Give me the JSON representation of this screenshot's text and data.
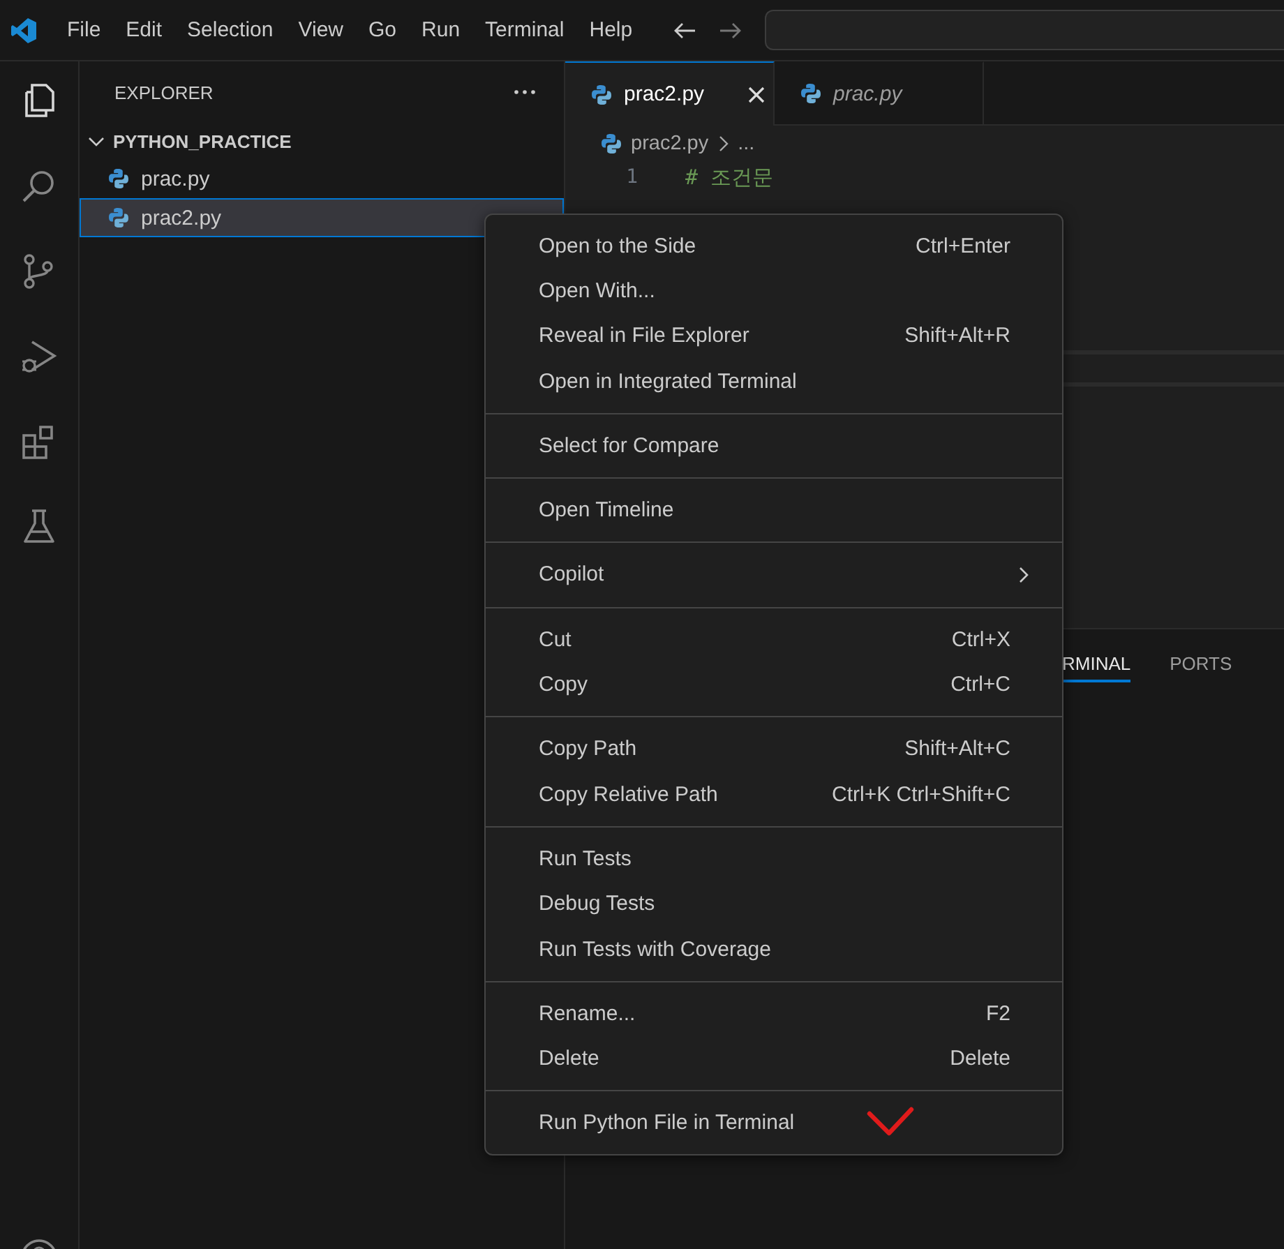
{
  "menu_bar": [
    "File",
    "Edit",
    "Selection",
    "View",
    "Go",
    "Run",
    "Terminal",
    "Help"
  ],
  "activity_bar": [
    {
      "kind": "files",
      "selected": true
    },
    {
      "kind": "search",
      "selected": false
    },
    {
      "kind": "source_control",
      "selected": false
    },
    {
      "kind": "run_debug",
      "selected": false
    },
    {
      "kind": "extensions",
      "selected": false
    },
    {
      "kind": "testing",
      "selected": false
    },
    {
      "kind": "account",
      "selected": false
    }
  ],
  "explorer": {
    "title": "EXPLORER",
    "folder": {
      "name": "PYTHON_PRACTICE",
      "expanded": true,
      "children": [
        {
          "name": "prac.py",
          "selected": false
        },
        {
          "name": "prac2.py",
          "selected": true
        }
      ]
    }
  },
  "tabs": [
    {
      "label": "prac2.py",
      "selected": true,
      "preview": false
    },
    {
      "label": "prac.py",
      "selected": false,
      "preview": true
    }
  ],
  "breadcrumb": [
    "prac2.py",
    "..."
  ],
  "code_lines": [
    {
      "number": "1",
      "text": "# 조건문"
    }
  ],
  "panel_tabs": [
    {
      "label": "RMINAL",
      "selected": true
    },
    {
      "label": "PORTS",
      "selected": false
    }
  ],
  "context_menu": [
    [
      {
        "label": "Open to the Side",
        "shortcut": "Ctrl+Enter"
      },
      {
        "label": "Open With..."
      },
      {
        "label": "Reveal in File Explorer",
        "shortcut": "Shift+Alt+R"
      },
      {
        "label": "Open in Integrated Terminal"
      }
    ],
    [
      {
        "label": "Select for Compare"
      }
    ],
    [
      {
        "label": "Open Timeline"
      }
    ],
    [
      {
        "label": "Copilot",
        "submenu": true
      }
    ],
    [
      {
        "label": "Cut",
        "shortcut": "Ctrl+X"
      },
      {
        "label": "Copy",
        "shortcut": "Ctrl+C"
      }
    ],
    [
      {
        "label": "Copy Path",
        "shortcut": "Shift+Alt+C"
      },
      {
        "label": "Copy Relative Path",
        "shortcut": "Ctrl+K Ctrl+Shift+C"
      }
    ],
    [
      {
        "label": "Run Tests"
      },
      {
        "label": "Debug Tests"
      },
      {
        "label": "Run Tests with Coverage"
      }
    ],
    [
      {
        "label": "Rename...",
        "shortcut": "F2"
      },
      {
        "label": "Delete",
        "shortcut": "Delete"
      }
    ],
    [
      {
        "label": "Run Python File in Terminal"
      }
    ]
  ]
}
